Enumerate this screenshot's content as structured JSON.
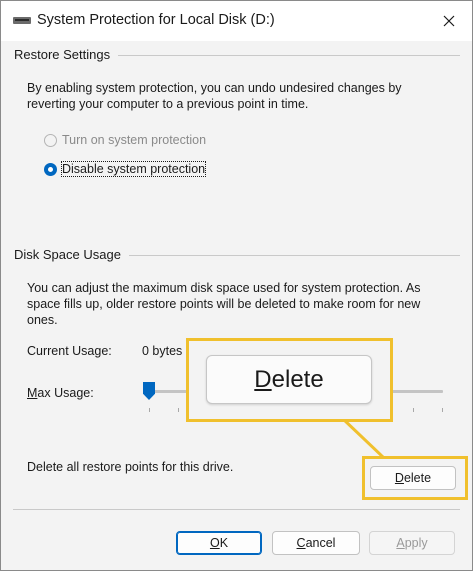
{
  "window": {
    "title": "System Protection for Local Disk (D:)",
    "close_icon": "close-icon"
  },
  "restore": {
    "section_title": "Restore Settings",
    "description": "By enabling system protection, you can undo undesired changes by reverting your computer to a previous point in time.",
    "options": [
      {
        "label": "Turn on system protection",
        "selected": false,
        "enabled": false
      },
      {
        "label": "Disable system protection",
        "selected": true,
        "enabled": true
      }
    ]
  },
  "disk": {
    "section_title": "Disk Space Usage",
    "description": "You can adjust the maximum disk space used for system protection. As space fills up, older restore points will be deleted to make room for new ones.",
    "current_usage_label": "Current Usage:",
    "current_usage_value": "0 bytes",
    "max_usage_label_accel": "M",
    "max_usage_label_rest": "ax Usage:",
    "max_usage_value": 0,
    "delete_text": "Delete all restore points for this drive.",
    "delete_button_accel": "D",
    "delete_button_rest": "elete"
  },
  "callout": {
    "zoom_label_accel": "D",
    "zoom_label_rest": "elete",
    "highlight_color": "#f0c02d"
  },
  "footer": {
    "ok_accel": "O",
    "ok_rest": "K",
    "cancel_accel": "C",
    "cancel_rest": "ancel",
    "apply_accel": "A",
    "apply_rest": "pply"
  },
  "colors": {
    "accent": "#0067c0",
    "window_bg": "#f3f3f3",
    "disabled_text": "#8a8a8a"
  }
}
